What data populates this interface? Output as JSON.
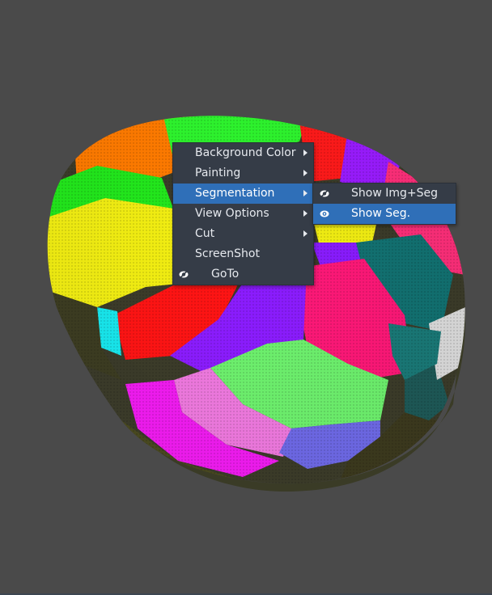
{
  "context_menu": {
    "items": [
      {
        "label": "Background Color",
        "has_submenu": true
      },
      {
        "label": "Painting",
        "has_submenu": true
      },
      {
        "label": "Segmentation",
        "has_submenu": true,
        "active": true
      },
      {
        "label": "View Options",
        "has_submenu": true
      },
      {
        "label": "Cut",
        "has_submenu": true
      },
      {
        "label": "ScreenShot",
        "has_submenu": false
      },
      {
        "label": "GoTo",
        "has_submenu": false,
        "icon": "eye-icon"
      }
    ]
  },
  "submenu": {
    "items": [
      {
        "label": "Show Img+Seg",
        "icon": "eye-slash-icon"
      },
      {
        "label": "Show Seg.",
        "icon": "eye-icon",
        "active": true
      }
    ]
  },
  "colors": {
    "viewport_background": "#4a4a4a",
    "menu_background": "#353c47",
    "menu_highlight": "#2f6fb8"
  }
}
